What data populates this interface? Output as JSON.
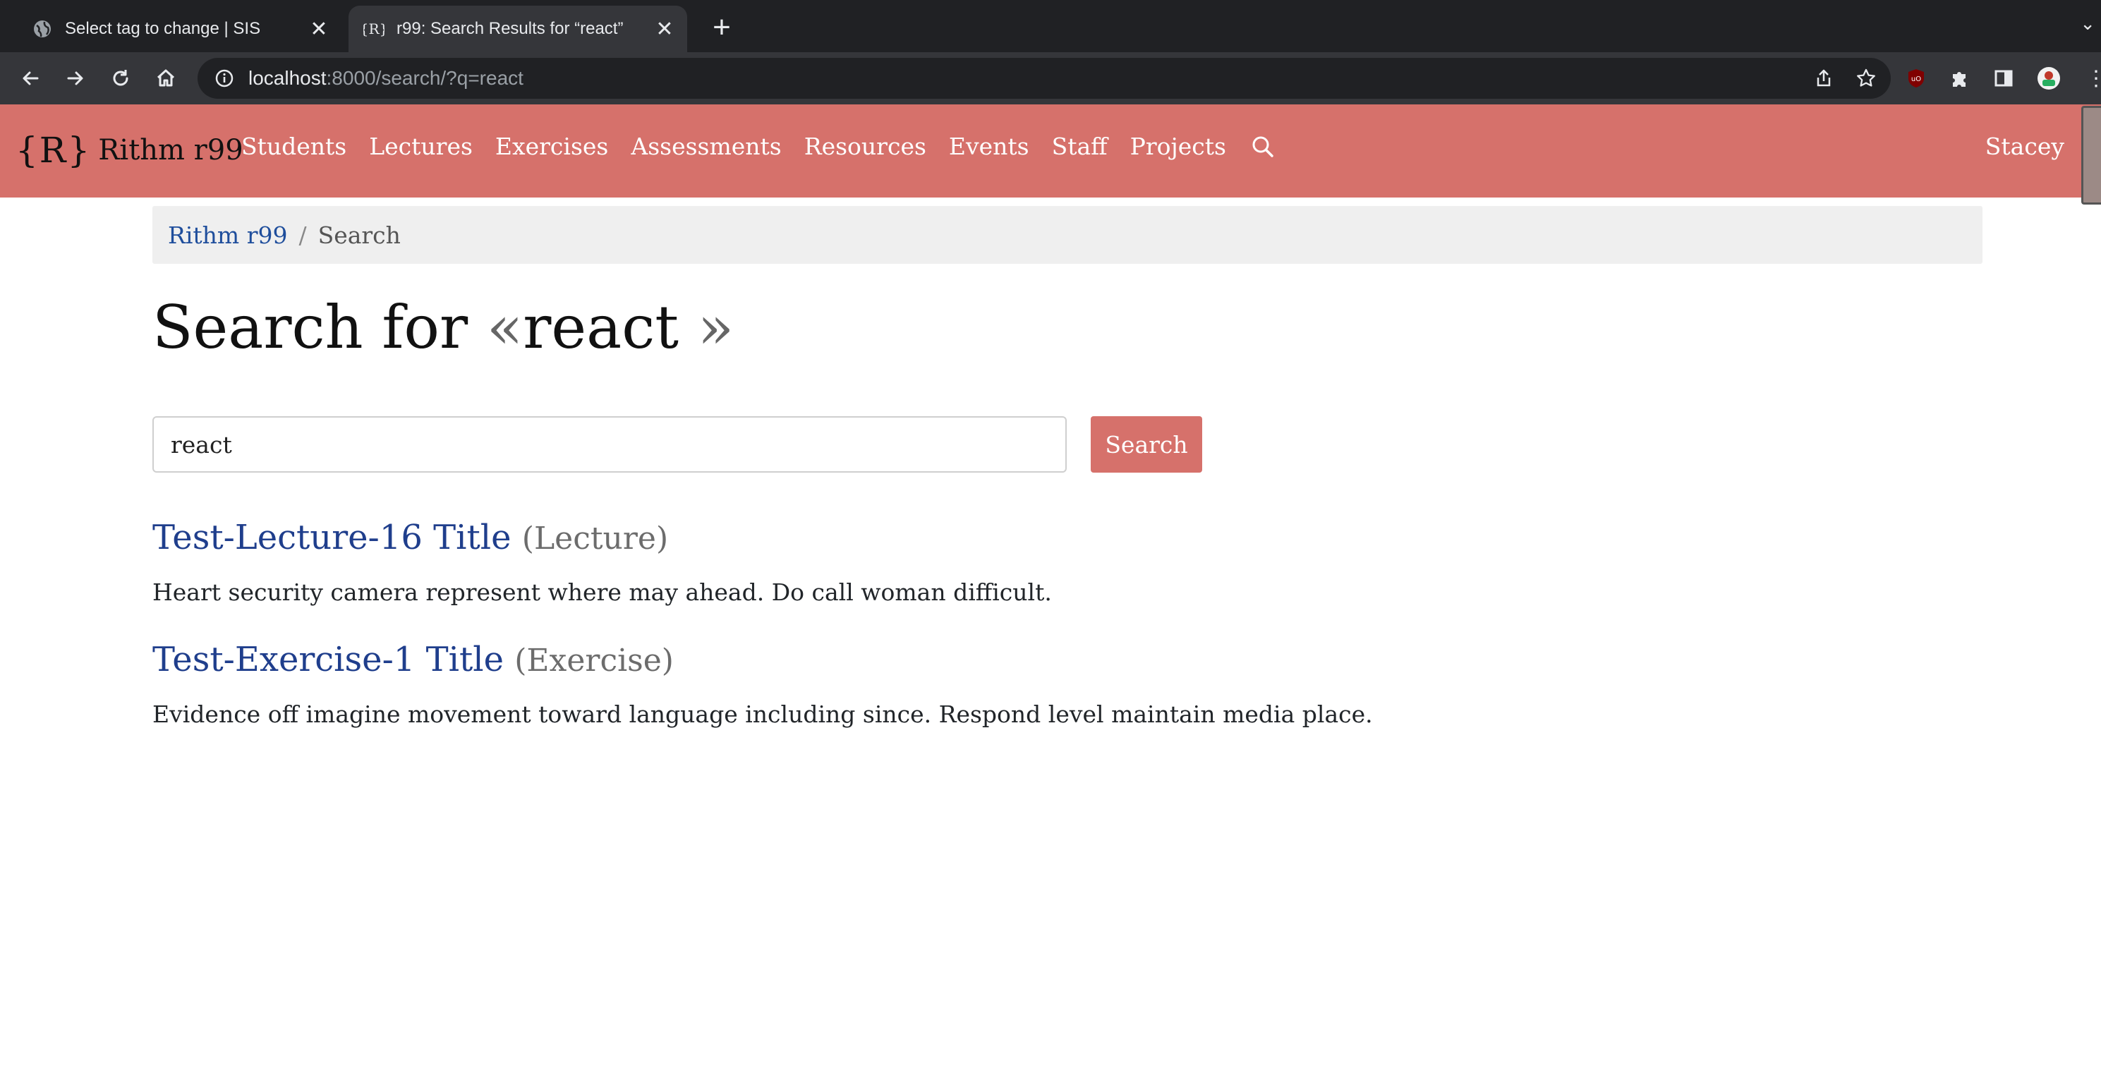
{
  "browser": {
    "tabs": [
      {
        "title": "Select tag to change | SIS",
        "icon": "globe-icon",
        "active": false
      },
      {
        "title": "r99: Search Results for “react”",
        "icon": "rithm-favicon",
        "active": true
      }
    ],
    "url_host": "localhost",
    "url_rest": ":8000/search/?q=react"
  },
  "site": {
    "logo": "{R}",
    "brand": "Rithm r99",
    "nav": [
      "Students",
      "Lectures",
      "Exercises",
      "Assessments",
      "Resources",
      "Events",
      "Staff",
      "Projects"
    ],
    "user": "Stacey",
    "accent_color": "#d6716b"
  },
  "breadcrumb": {
    "home": "Rithm r99",
    "separator": "/",
    "current": "Search"
  },
  "heading": {
    "prefix": "Search for",
    "open_quote": "«",
    "term": "react",
    "close_quote": "»"
  },
  "search": {
    "value": "react",
    "button": "Search"
  },
  "results": [
    {
      "title": "Test-Lecture-16 Title",
      "type": "(Lecture)",
      "description": "Heart security camera represent where may ahead. Do call woman difficult."
    },
    {
      "title": "Test-Exercise-1 Title",
      "type": "(Exercise)",
      "description": "Evidence off imagine movement toward language including since. Respond level maintain media place."
    }
  ]
}
